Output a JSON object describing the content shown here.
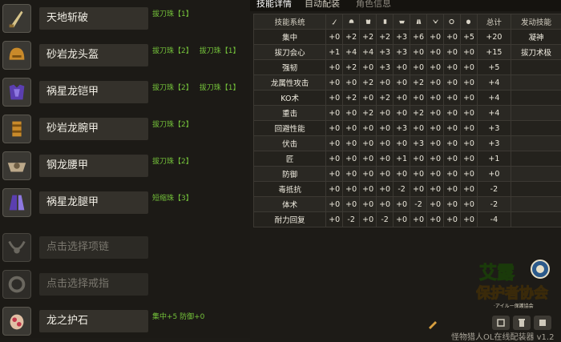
{
  "equipment": [
    {
      "name": "天地斩破",
      "gems": [
        "拔刀珠【1】"
      ],
      "icon": "katana-icon",
      "empty": false
    },
    {
      "name": "砂岩龙头盔",
      "gems": [
        "拔刀珠【2】",
        "拔刀珠【1】"
      ],
      "icon": "helmet-icon",
      "empty": false
    },
    {
      "name": "祸星龙铠甲",
      "gems": [
        "拔刀珠【2】",
        "拔刀珠【1】"
      ],
      "icon": "chest-armor-icon",
      "empty": false
    },
    {
      "name": "砂岩龙腕甲",
      "gems": [
        "拔刀珠【2】"
      ],
      "icon": "gauntlet-icon",
      "empty": false
    },
    {
      "name": "钢龙腰甲",
      "gems": [
        "拔刀珠【2】"
      ],
      "icon": "waist-armor-icon",
      "empty": false
    },
    {
      "name": "祸星龙腿甲",
      "gems": [
        "短缩珠【3】"
      ],
      "icon": "leg-armor-icon",
      "empty": false
    },
    {
      "name": "点击选择项链",
      "gems": [],
      "icon": "necklace-icon",
      "empty": true
    },
    {
      "name": "点击选择戒指",
      "gems": [],
      "icon": "ring-icon",
      "empty": true
    },
    {
      "name": "龙之护石",
      "gems": [
        "集中+5 防御+0"
      ],
      "icon": "talisman-icon",
      "empty": false
    }
  ],
  "tabs": [
    {
      "label": "技能详情",
      "active": true
    },
    {
      "label": "自动配装",
      "active": false
    },
    {
      "label": "角色信息",
      "active": false
    }
  ],
  "skill_table": {
    "headers": {
      "skill_system": "技能系统",
      "total": "总计",
      "activated": "发动技能"
    },
    "header_icons": [
      "katana-icon",
      "helmet-icon",
      "chest-armor-icon",
      "gauntlet-icon",
      "waist-armor-icon",
      "leg-armor-icon",
      "necklace-icon",
      "ring-icon",
      "talisman-icon"
    ],
    "rows": [
      {
        "name": "集中",
        "values": [
          "+0",
          "+2",
          "+2",
          "+2",
          "+3",
          "+6",
          "+0",
          "+0",
          "+5"
        ],
        "total": "+20",
        "skill": "凝神"
      },
      {
        "name": "拔刀会心",
        "values": [
          "+1",
          "+4",
          "+4",
          "+3",
          "+3",
          "+0",
          "+0",
          "+0",
          "+0"
        ],
        "total": "+15",
        "skill": "拔刀术极"
      },
      {
        "name": "强韧",
        "values": [
          "+0",
          "+2",
          "+0",
          "+3",
          "+0",
          "+0",
          "+0",
          "+0",
          "+0"
        ],
        "total": "+5",
        "skill": ""
      },
      {
        "name": "龙属性攻击",
        "values": [
          "+0",
          "+0",
          "+2",
          "+0",
          "+0",
          "+2",
          "+0",
          "+0",
          "+0"
        ],
        "total": "+4",
        "skill": ""
      },
      {
        "name": "KO术",
        "values": [
          "+0",
          "+2",
          "+0",
          "+2",
          "+0",
          "+0",
          "+0",
          "+0",
          "+0"
        ],
        "total": "+4",
        "skill": ""
      },
      {
        "name": "重击",
        "values": [
          "+0",
          "+0",
          "+2",
          "+0",
          "+0",
          "+2",
          "+0",
          "+0",
          "+0"
        ],
        "total": "+4",
        "skill": ""
      },
      {
        "name": "回避性能",
        "values": [
          "+0",
          "+0",
          "+0",
          "+0",
          "+3",
          "+0",
          "+0",
          "+0",
          "+0"
        ],
        "total": "+3",
        "skill": ""
      },
      {
        "name": "伏击",
        "values": [
          "+0",
          "+0",
          "+0",
          "+0",
          "+0",
          "+3",
          "+0",
          "+0",
          "+0"
        ],
        "total": "+3",
        "skill": ""
      },
      {
        "name": "匠",
        "values": [
          "+0",
          "+0",
          "+0",
          "+0",
          "+1",
          "+0",
          "+0",
          "+0",
          "+0"
        ],
        "total": "+1",
        "skill": ""
      },
      {
        "name": "防御",
        "values": [
          "+0",
          "+0",
          "+0",
          "+0",
          "+0",
          "+0",
          "+0",
          "+0",
          "+0"
        ],
        "total": "+0",
        "skill": ""
      },
      {
        "name": "毒抵抗",
        "values": [
          "+0",
          "+0",
          "+0",
          "+0",
          "-2",
          "+0",
          "+0",
          "+0",
          "+0"
        ],
        "total": "-2",
        "skill": ""
      },
      {
        "name": "体术",
        "values": [
          "+0",
          "+0",
          "+0",
          "+0",
          "+0",
          "-2",
          "+0",
          "+0",
          "+0"
        ],
        "total": "-2",
        "skill": ""
      },
      {
        "name": "耐力回复",
        "values": [
          "+0",
          "-2",
          "+0",
          "-2",
          "+0",
          "+0",
          "+0",
          "+0",
          "+0"
        ],
        "total": "-4",
        "skill": ""
      }
    ]
  },
  "logo": {
    "line1": "艾露",
    "line2": "保护者协会",
    "sub": "·アイルー保護協会"
  },
  "footer": {
    "text": "怪物猎人OL在线配装器 v1.2"
  },
  "colors": {
    "gem_green": "#74c23a",
    "background": "#1d1b17"
  }
}
